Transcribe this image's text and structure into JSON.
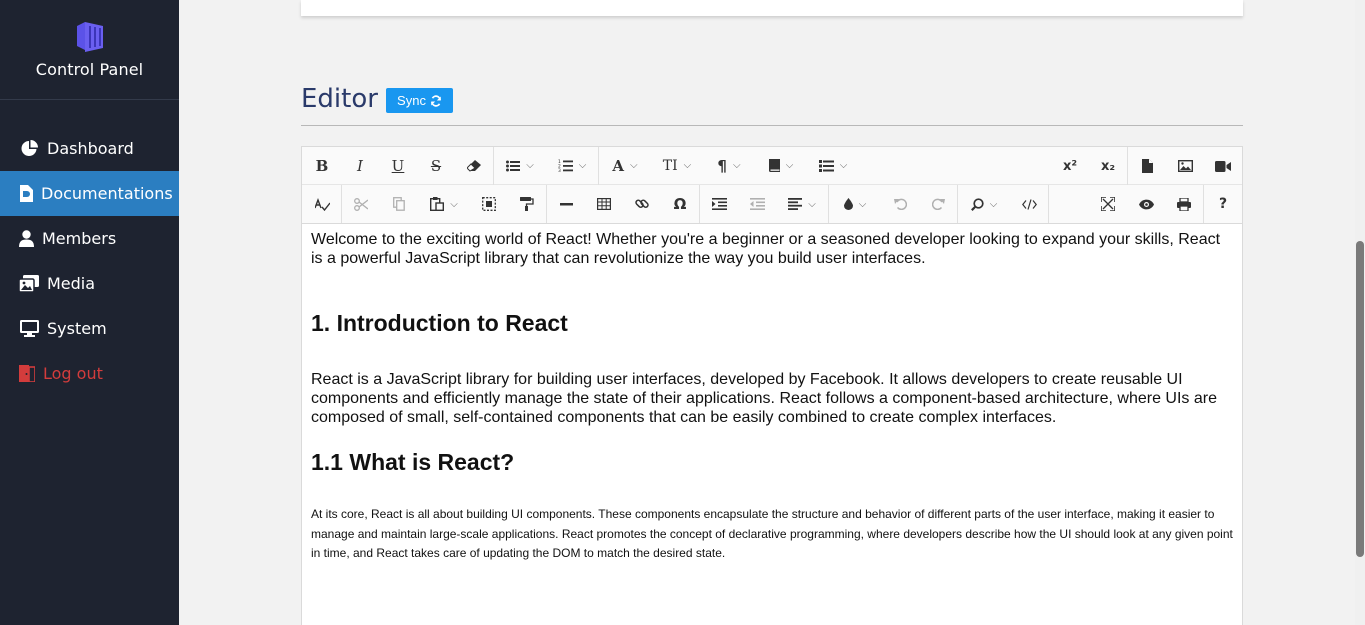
{
  "sidebar": {
    "brand": "Control Panel",
    "items": [
      {
        "label": "Dashboard",
        "icon": "pie-chart-icon"
      },
      {
        "label": "Documentations",
        "icon": "file-icon"
      },
      {
        "label": "Members",
        "icon": "user-icon"
      },
      {
        "label": "Media",
        "icon": "images-icon"
      },
      {
        "label": "System",
        "icon": "monitor-icon"
      },
      {
        "label": "Log out",
        "icon": "door-icon"
      }
    ],
    "active_index": 1
  },
  "editor": {
    "title": "Editor",
    "sync_label": "Sync",
    "toolbar_row1": {
      "bold": "B",
      "italic": "I",
      "underline": "U",
      "strike": "S",
      "font_color": "A",
      "font_size": "TI",
      "paragraph": "¶",
      "superscript": "x²",
      "subscript": "x₂"
    },
    "toolbar_row2": {
      "special_char": "Ω",
      "help": "?"
    }
  },
  "content": {
    "intro": "Welcome to the exciting world of React! Whether you're a beginner or a seasoned developer looking to expand your skills, React is a powerful JavaScript library that can revolutionize the way you build user interfaces.",
    "h1": "1. Introduction to React",
    "p1": "React is a JavaScript library for building user interfaces, developed by Facebook. It allows developers to create reusable UI components and efficiently manage the state of their applications. React follows a component-based architecture, where UIs are composed of small, self-contained components that can be easily combined to create complex interfaces.",
    "h2": "1.1 What is React?",
    "p2": "At its core, React is all about building UI components. These components encapsulate the structure and behavior of different parts of the user interface, making it easier to manage and maintain large-scale applications. React promotes the concept of declarative programming, where developers describe how the UI should look at any given point in time, and React takes care of updating the DOM to match the desired state."
  },
  "colors": {
    "sidebar_bg": "#1e2330",
    "active": "#2b7ec1",
    "logout": "#d33c3c",
    "sync_btn": "#1997f0",
    "title": "#2a3a6a"
  }
}
